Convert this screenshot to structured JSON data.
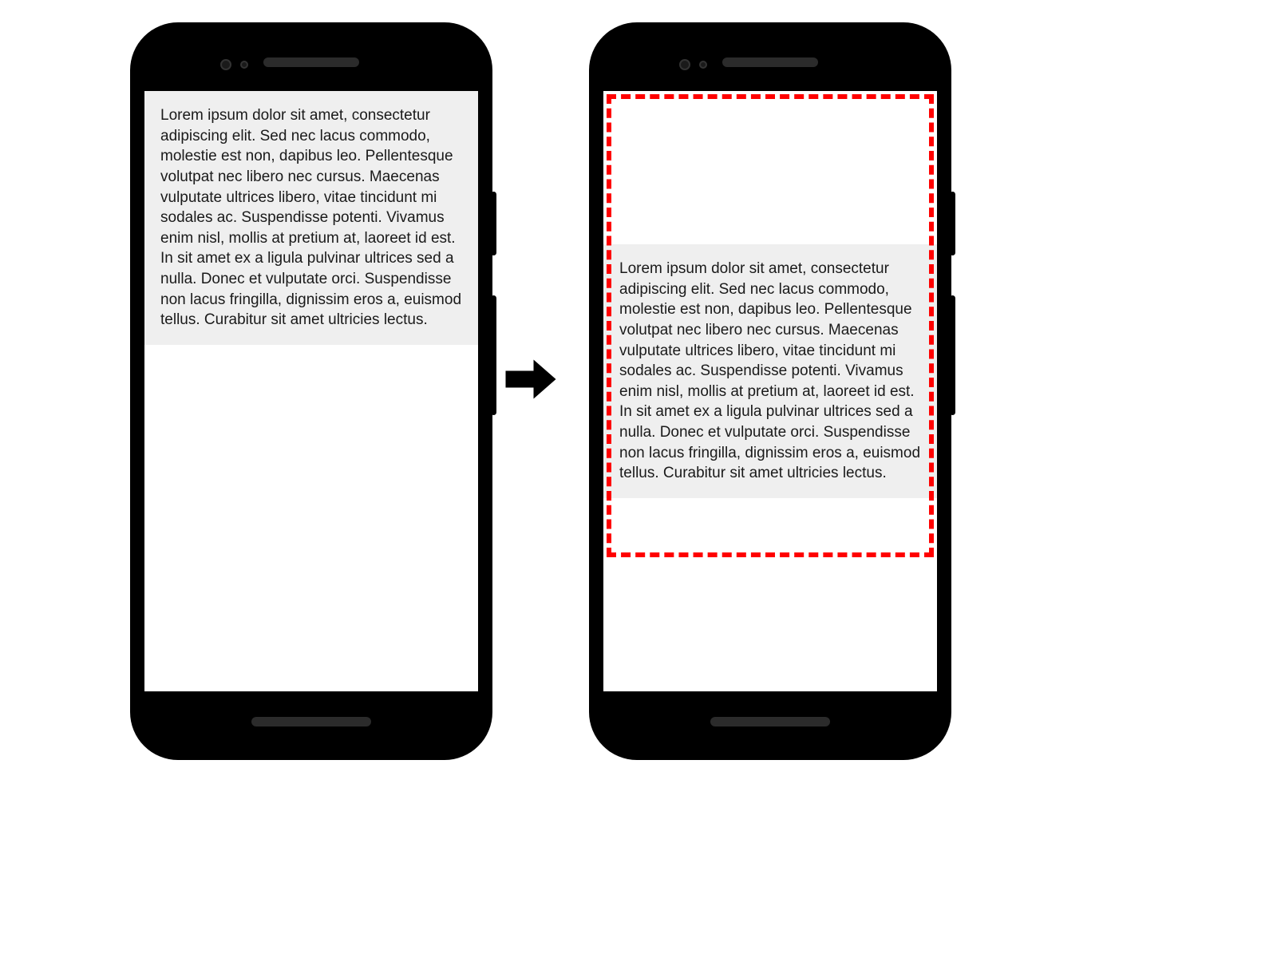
{
  "diagram": {
    "lorem_text": "Lorem ipsum dolor sit amet, consectetur adipiscing elit. Sed nec lacus commodo, molestie est non, dapibus leo. Pellentesque volutpat nec libero nec cursus. Maecenas vulputate ultrices libero, vitae tincidunt mi sodales ac. Suspendisse potenti. Vivamus enim nisl, mollis at pretium at, laoreet id est. In sit amet ex a ligula pulvinar ultrices sed a nulla. Donec et vulputate orci. Suspendisse non lacus fringilla, dignissim eros a, euismod tellus. Curabitur sit amet ultricies lectus."
  }
}
